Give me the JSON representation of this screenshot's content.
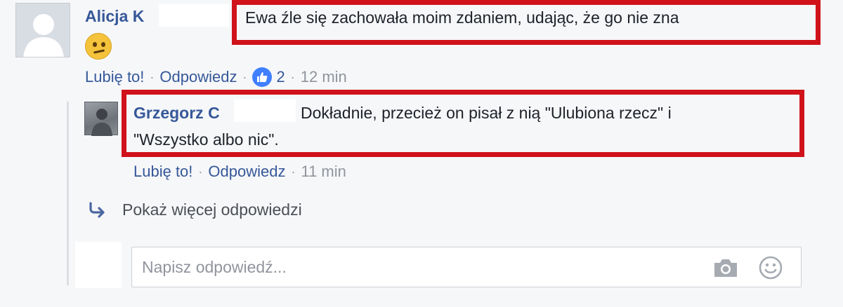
{
  "comment": {
    "author": "Alicja K",
    "text": "Ewa źle się zachowała moim zdaniem, udając, że go nie zna",
    "emoji_icon": "confused-face-emoji",
    "actions": {
      "like": "Lubię to!",
      "reply": "Odpowiedz",
      "like_count": "2",
      "time": "12 min"
    }
  },
  "reply": {
    "author": "Grzegorz C",
    "text_line1": "Dokładnie, przecież on pisał z nią \"Ulubiona rzecz\" i",
    "text_line2": "\"Wszystko albo nic\".",
    "actions": {
      "like": "Lubię to!",
      "reply": "Odpowiedz",
      "time": "11 min"
    }
  },
  "more_replies": {
    "label": "Pokaż więcej odpowiedzi",
    "icon": "reply-arrow-icon"
  },
  "compose": {
    "placeholder": "Napisz odpowiedź...",
    "icons": [
      "camera-icon",
      "smiley-icon"
    ]
  },
  "colors": {
    "link": "#365899",
    "highlight": "#d0121b",
    "like_blue": "#4080ff",
    "muted": "#90949c"
  },
  "separator": "·"
}
